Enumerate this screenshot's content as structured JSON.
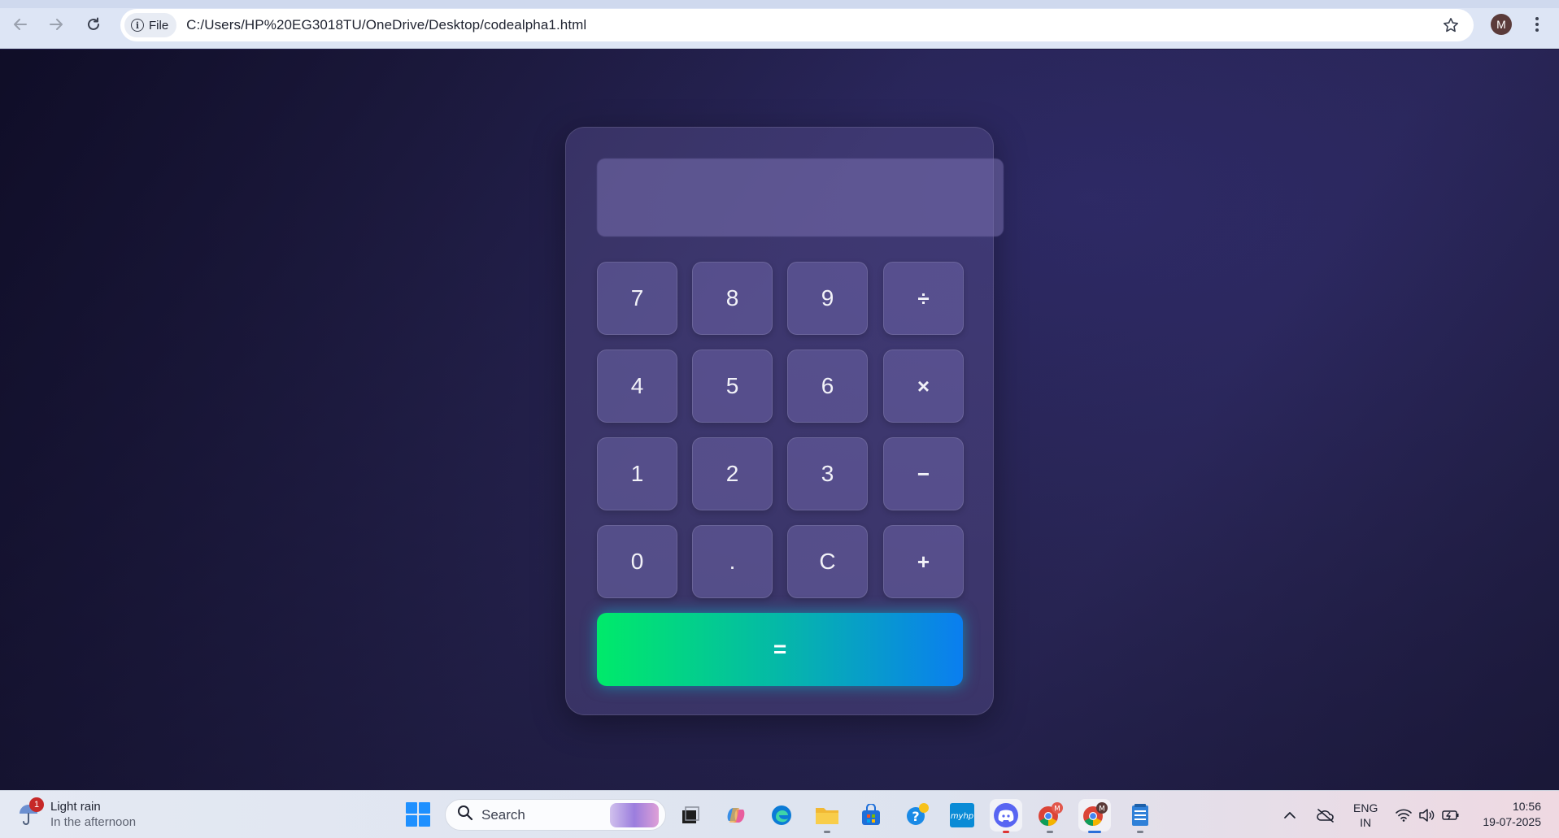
{
  "browser": {
    "site_chip_label": "File",
    "url": "C:/Users/HP%20EG3018TU/OneDrive/Desktop/codealpha1.html",
    "profile_initial": "M",
    "icons": {
      "back": "arrow-left-icon",
      "forward": "arrow-right-icon",
      "reload": "reload-icon",
      "info": "info-icon",
      "bookmark": "star-icon",
      "menu": "kebab-menu-icon"
    }
  },
  "calculator": {
    "display_value": "",
    "keys": [
      {
        "label": "7",
        "kind": "digit"
      },
      {
        "label": "8",
        "kind": "digit"
      },
      {
        "label": "9",
        "kind": "digit"
      },
      {
        "label": "÷",
        "kind": "operator"
      },
      {
        "label": "4",
        "kind": "digit"
      },
      {
        "label": "5",
        "kind": "digit"
      },
      {
        "label": "6",
        "kind": "digit"
      },
      {
        "label": "×",
        "kind": "operator"
      },
      {
        "label": "1",
        "kind": "digit"
      },
      {
        "label": "2",
        "kind": "digit"
      },
      {
        "label": "3",
        "kind": "digit"
      },
      {
        "label": "−",
        "kind": "operator"
      },
      {
        "label": "0",
        "kind": "digit"
      },
      {
        "label": ".",
        "kind": "digit"
      },
      {
        "label": "C",
        "kind": "clear"
      },
      {
        "label": "+",
        "kind": "operator"
      }
    ],
    "equals_label": "=",
    "colors": {
      "equals_gradient_start": "#00ea6a",
      "equals_gradient_end": "#0a7ef0"
    }
  },
  "taskbar": {
    "weather": {
      "title": "Light rain",
      "subtitle": "In the afternoon",
      "badge": "1",
      "icon": "umbrella-icon"
    },
    "search_placeholder": "Search",
    "apps": [
      "task-view-icon",
      "copilot-icon",
      "edge-icon",
      "file-explorer-icon",
      "microsoft-store-icon",
      "help-icon",
      "myhp-icon",
      "discord-icon",
      "chrome-profile-icon",
      "chrome-icon",
      "notepad-icon"
    ],
    "myhp_label": "myhp",
    "chrome_badges": [
      "M",
      "M"
    ],
    "tray": {
      "language_line1": "ENG",
      "language_line2": "IN"
    },
    "clock": {
      "time": "10:56",
      "date": "19-07-2025"
    }
  }
}
